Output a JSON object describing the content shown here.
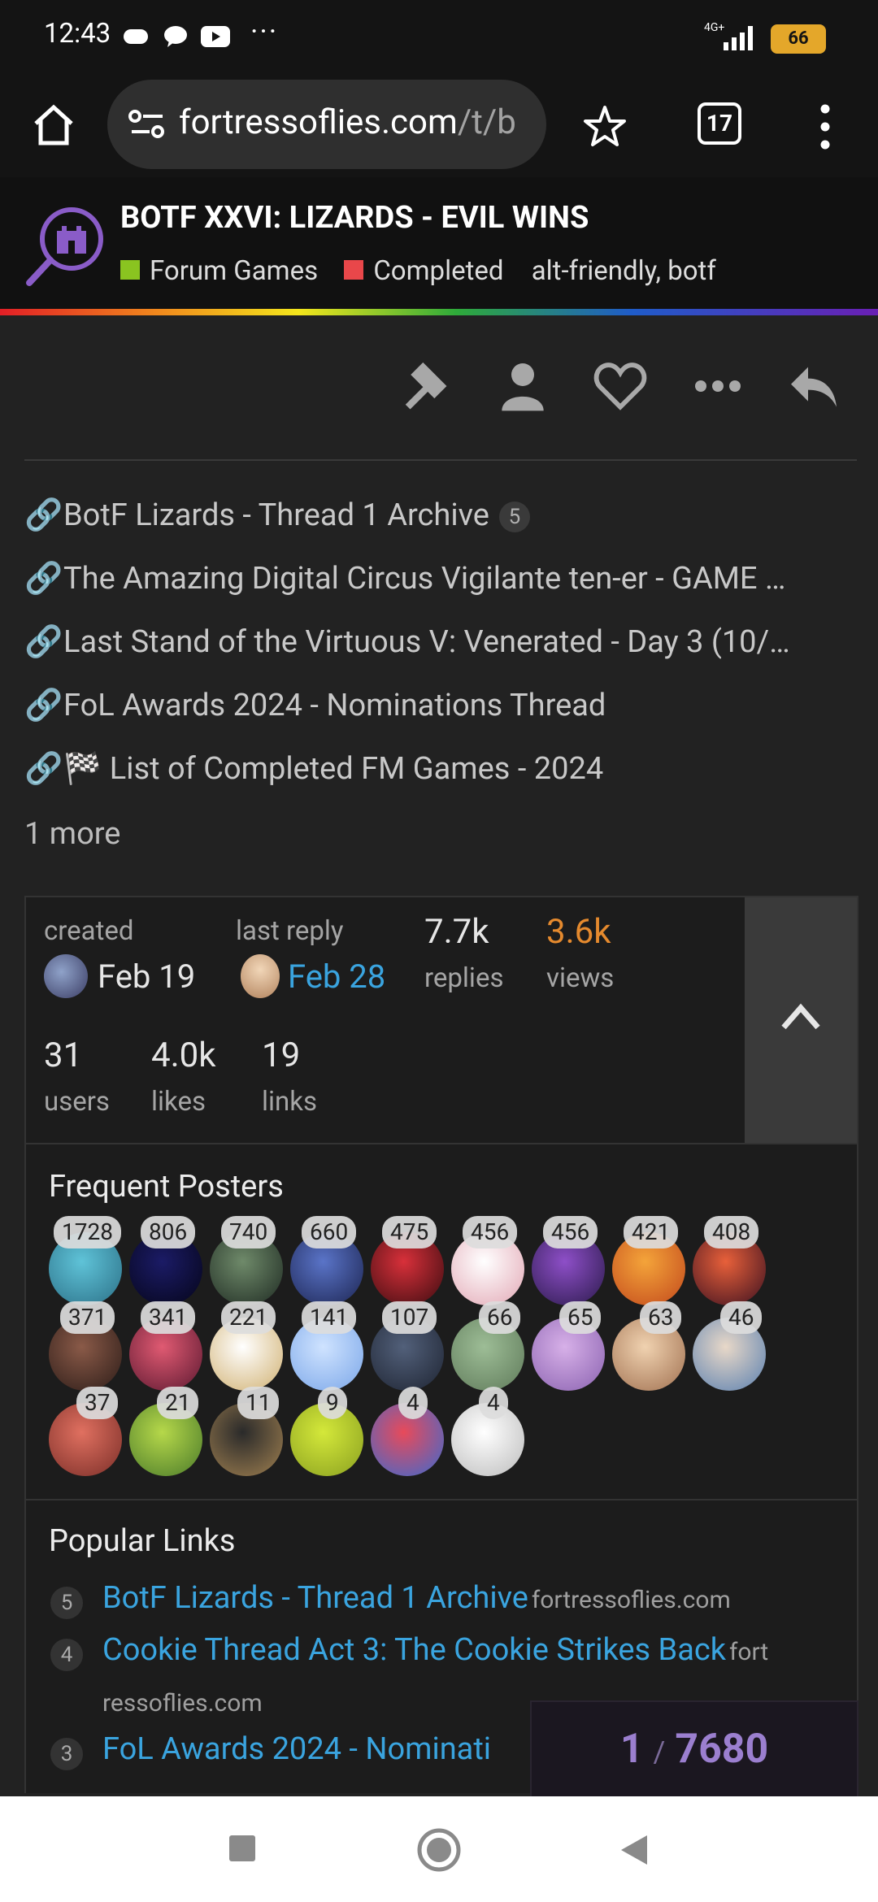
{
  "status_bar": {
    "time": "12:43",
    "more": "···",
    "network": "4G+",
    "battery": "66"
  },
  "browser": {
    "url_main": "fortressoflies.com",
    "url_path": "/t/b",
    "tab_count": "17"
  },
  "topic": {
    "title": "BOTF XXVI: LIZARDS - EVIL WINS",
    "category": "Forum Games",
    "category_color": "#8ac420",
    "status": "Completed",
    "status_color": "#e9474a",
    "tags": "alt-friendly,  botf"
  },
  "linked_topics": [
    {
      "text": "BotF Lizards - Thread 1 Archive",
      "count": "5"
    },
    {
      "text": "The Amazing Digital Circus Vigilante ten-er - GAME …"
    },
    {
      "text": "Last Stand of the Virtuous V: Venerated - Day 3 (10/…"
    },
    {
      "text": "FoL Awards 2024 - Nominations Thread"
    },
    {
      "text": "List of Completed FM Games - 2024",
      "emoji": "🏁"
    }
  ],
  "more_link": "1 more",
  "stats": {
    "created_label": "created",
    "created_value": "Feb 19",
    "last_reply_label": "last reply",
    "last_reply_value": "Feb 28",
    "replies_value": "7.7k",
    "replies_label": "replies",
    "views_value": "3.6k",
    "views_label": "views",
    "users_value": "31",
    "users_label": "users",
    "likes_value": "4.0k",
    "likes_label": "likes",
    "links_value": "19",
    "links_label": "links"
  },
  "frequent_posters": {
    "heading": "Frequent Posters",
    "counts": [
      "1728",
      "806",
      "740",
      "660",
      "475",
      "456",
      "456",
      "421",
      "408",
      "371",
      "341",
      "221",
      "141",
      "107",
      "66",
      "65",
      "63",
      "46",
      "37",
      "21",
      "11",
      "9",
      "4",
      "4"
    ]
  },
  "popular_links": {
    "heading": "Popular Links",
    "items": [
      {
        "num": "5",
        "text": "BotF Lizards - Thread 1 Archive",
        "domain": "fortressoflies.com"
      },
      {
        "num": "4",
        "text": "Cookie Thread Act 3: The Cookie Strikes Back",
        "domain": "fort",
        "domain_wrap": "ressoflies.com"
      },
      {
        "num": "3",
        "text": "FoL Awards 2024 - Nominati"
      }
    ]
  },
  "progress": {
    "current": "1",
    "total": "7680"
  }
}
